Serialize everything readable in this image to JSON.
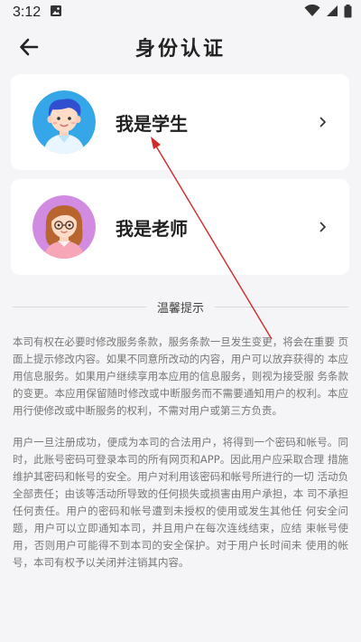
{
  "status_bar": {
    "time": "3:12"
  },
  "header": {
    "title": "身份认证"
  },
  "cards": [
    {
      "label": "我是学生"
    },
    {
      "label": "我是老师"
    }
  ],
  "tips": {
    "heading": "温馨提示",
    "paragraphs": [
      "本司有权在必要时修改服务条款，服务条款一旦发生变更，将会在重要 页面上提示修改内容。如果不同意所改动的内容，用户可以放弃获得的 本应用信息服务。如果用户继续享用本应用的信息服务，则视为接受服 务条款的变更。本应用保留随时修改或中断服务而不需要通知用户的权利。本应用行使修改或中断服务的权利，不需对用户或第三方负责。",
      "用户一旦注册成功，便成为本司的合法用户，将得到一个密码和帐号。同时，此账号密码可登录本司的所有网页和APP。因此用户应采取合理 措施维护其密码和帐号的安全。用户对利用该密码和帐号所进行的一切 活动负全部责任；由该等活动所导致的任何损失或损害由用户承担，本 司不承担任何责任。用户的密码和帐号遭到未授权的使用或发生其他任 何安全问题，用户可以立即通知本司，并且用户在每次连线结束，应结 束帐号使用，否则用户可能得不到本司的安全保护。对于用户长时间未 使用的帐号，本司有权予以关闭并注销其内容。"
    ]
  },
  "colors": {
    "background": "#f5f5f7",
    "card": "#ffffff",
    "annotation_arrow": "#d12a2a"
  }
}
